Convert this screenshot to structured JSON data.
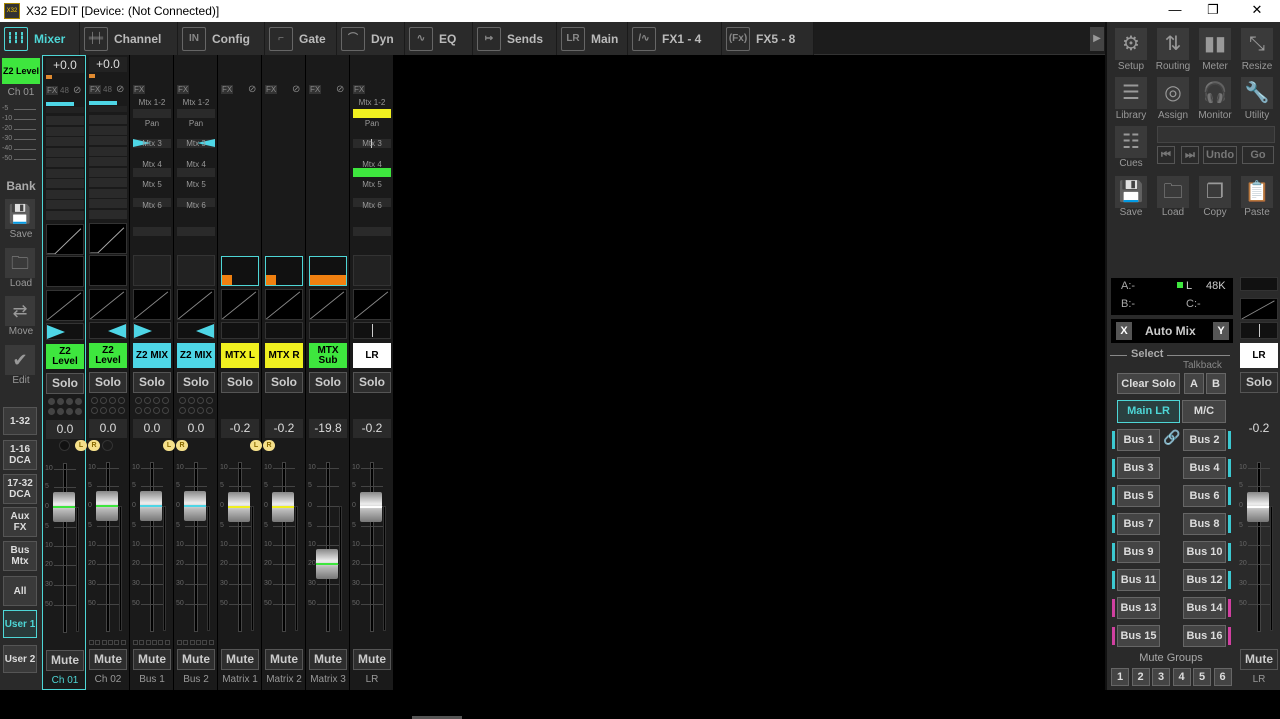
{
  "window": {
    "title": "X32 EDIT [Device: (Not Connected)]",
    "logo": "X32 EDIT",
    "minimize": "—",
    "maximize": "❐",
    "close": "✕"
  },
  "tabs": [
    {
      "label": "Mixer",
      "icon": "mixer-icon",
      "glyph": "┇┇┇",
      "active": true
    },
    {
      "label": "Channel",
      "icon": "channel-icon",
      "glyph": "╪╪"
    },
    {
      "label": "Config",
      "icon": "config-icon",
      "glyph": "IN"
    },
    {
      "label": "Gate",
      "icon": "gate-icon",
      "glyph": "⌐"
    },
    {
      "label": "Dyn",
      "icon": "dyn-icon",
      "glyph": "⌒"
    },
    {
      "label": "EQ",
      "icon": "eq-icon",
      "glyph": "∿"
    },
    {
      "label": "Sends",
      "icon": "sends-icon",
      "glyph": "↦"
    },
    {
      "label": "Main",
      "icon": "main-icon",
      "glyph": "LR"
    },
    {
      "label": "FX1 - 4",
      "icon": "fx-wave-icon",
      "glyph": "/∿"
    },
    {
      "label": "FX5 - 8",
      "icon": "fx-icon",
      "glyph": "(Fx)"
    }
  ],
  "tab_scroll": "▶",
  "left": {
    "layer": "Z2 Level",
    "channel": "Ch 01",
    "meter_ticks": [
      "-5",
      "-10",
      "-20",
      "-30",
      "-40",
      "-50"
    ],
    "bank": "Bank",
    "save": "Save",
    "load": "Load",
    "move": "Move",
    "edit": "Edit",
    "banks": [
      "1-32",
      "1-16 DCA",
      "17-32 DCA",
      "Aux FX",
      "Bus Mtx",
      "All",
      "User 1",
      "User 2"
    ]
  },
  "strips": [
    {
      "name": "Z2 Level",
      "color": "#3ee63e",
      "value": "0.0",
      "gain": "+0.0",
      "label": "Ch 01",
      "fader_db": 0,
      "line": "#3ee63e",
      "selected": true,
      "fx": "FX",
      "p48": "48"
    },
    {
      "name": "Z2 Level",
      "color": "#3ee63e",
      "value": "0.0",
      "gain": "+0.0",
      "label": "Ch 02",
      "fader_db": 0,
      "line": "#3ee63e",
      "fx": "FX",
      "p48": "48"
    },
    {
      "name": "Z2 MIX",
      "color": "#4ed6e6",
      "value": "0.0",
      "label": "Bus 1",
      "fader_db": 0,
      "line": "#4ed6e6",
      "fx": "FX"
    },
    {
      "name": "Z2 MIX",
      "color": "#4ed6e6",
      "value": "0.0",
      "label": "Bus 2",
      "fader_db": 0,
      "line": "#4ed6e6",
      "fx": "FX"
    },
    {
      "name": "MTX L",
      "color": "#f0f020",
      "value": "-0.2",
      "label": "Matrix 1",
      "fader_db": -0.2,
      "line": "#f0f020",
      "fx": "FX"
    },
    {
      "name": "MTX R",
      "color": "#f0f020",
      "value": "-0.2",
      "label": "Matrix 2",
      "fader_db": -0.2,
      "line": "#f0f020",
      "fx": "FX"
    },
    {
      "name": "MTX Sub",
      "color": "#3ee63e",
      "value": "-19.8",
      "label": "Matrix 3",
      "fader_db": -19.8,
      "line": "#3ee63e",
      "fx": "FX"
    },
    {
      "name": "LR",
      "color": "#ffffff",
      "value": "-0.2",
      "label": "LR",
      "fader_db": -0.2,
      "line": "#ffffff",
      "fx": "FX"
    }
  ],
  "sends": [
    "Mtx 1-2",
    "Pan",
    "Mtx 3",
    "Mtx 4",
    "Mtx 5",
    "Mtx 6"
  ],
  "solo": "Solo",
  "mute": "Mute",
  "lr_l": "L",
  "lr_r": "R",
  "fader_ticks": [
    "10",
    "5",
    "0",
    "5",
    "10",
    "20",
    "30",
    "50"
  ],
  "right": {
    "tools": [
      "Setup",
      "Routing",
      "Meter",
      "Resize",
      "Library",
      "Assign",
      "Monitor",
      "Utility"
    ],
    "cues": "Cues",
    "undo": "Undo",
    "go": "Go",
    "prev": "⏮",
    "next": "⏭",
    "file": [
      "Save",
      "Load",
      "Copy",
      "Paste"
    ],
    "status": {
      "a": "A:-",
      "b": "B:-",
      "l": "L",
      "rate": "48K",
      "c": "C:-"
    },
    "automix": "Auto Mix",
    "x": "X",
    "y": "Y",
    "select": "Select",
    "talkback": "Talkback",
    "clear_solo": "Clear Solo",
    "tb_a": "A",
    "tb_b": "B",
    "main_lr": "Main LR",
    "mc": "M/C",
    "buses": [
      "Bus 1",
      "Bus 2",
      "Bus 3",
      "Bus 4",
      "Bus 5",
      "Bus 6",
      "Bus 7",
      "Bus 8",
      "Bus 9",
      "Bus 10",
      "Bus 11",
      "Bus 12",
      "Bus 13",
      "Bus 14",
      "Bus 15",
      "Bus 16"
    ],
    "bus_colors": [
      "#3cc8d0",
      "#3cc8d0",
      "#3cc8d0",
      "#3cc8d0",
      "#3cc8d0",
      "#3cc8d0",
      "#3cc8d0",
      "#3cc8d0",
      "#3cc8d0",
      "#3cc8d0",
      "#3cc8d0",
      "#3cc8d0",
      "#d040a0",
      "#d040a0",
      "#d040a0",
      "#d040a0"
    ],
    "mute_groups": "Mute Groups",
    "groups": [
      "1",
      "2",
      "3",
      "4",
      "5",
      "6"
    ],
    "lr": {
      "name": "LR",
      "value": "-0.2",
      "label": "LR",
      "fader_db": -0.2
    }
  }
}
